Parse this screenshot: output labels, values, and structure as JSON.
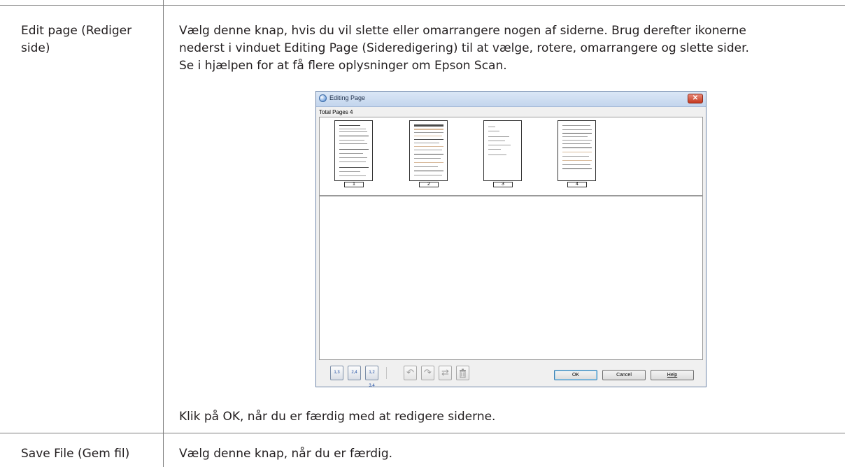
{
  "rows": [
    {
      "label": "Edit page (Rediger side)",
      "description": "Vælg denne knap, hvis du vil slette eller omarrangere nogen af siderne. Brug derefter ikonerne nederst i vinduet Editing Page (Sideredigering) til at vælge, rotere, omarrangere og slette sider. Se i hjælpen for at få flere oplysninger om Epson Scan.",
      "desc_lines": [
        "Vælg denne knap, hvis du vil slette eller omarrangere nogen af siderne. Brug derefter ikonerne",
        "nederst i vinduet Editing Page (Sideredigering) til at vælge, rotere, omarrangere og slette sider.",
        "Se i hjælpen for at få flere oplysninger om Epson Scan."
      ],
      "label_lines": [
        "Edit page (Rediger",
        "side)"
      ],
      "footer": "Klik på OK, når du er færdig med at redigere siderne."
    },
    {
      "label": "Save File (Gem fil)",
      "description": "Vælg denne knap, når du er færdig."
    }
  ],
  "dialog": {
    "title": "Editing Page",
    "total_pages": "Total Pages 4",
    "pages": [
      "1",
      "2",
      "3",
      "4"
    ],
    "toolbar_icons": [
      "select-odd-icon",
      "select-even-icon",
      "select-all-icon",
      "rotate-left-icon",
      "rotate-right-icon",
      "rearrange-icon",
      "delete-icon"
    ],
    "toolbar_glyphs": [
      "1,3",
      "2,4",
      "1,2 3,4",
      "↶",
      "↷",
      "⇄",
      "🗑"
    ],
    "buttons": {
      "ok": "OK",
      "cancel": "Cancel",
      "help": "Help"
    },
    "close_glyph": "✕"
  }
}
